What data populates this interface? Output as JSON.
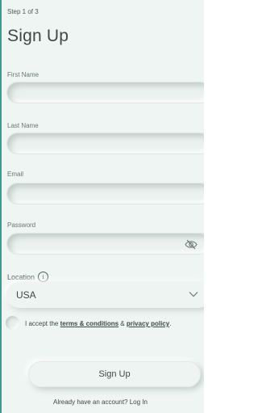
{
  "step": "Step 1 of 3",
  "title": "Sign Up",
  "fields": {
    "first_name": {
      "label": "First Name",
      "value": ""
    },
    "last_name": {
      "label": "Last Name",
      "value": ""
    },
    "email": {
      "label": "Email",
      "value": ""
    },
    "password": {
      "label": "Password",
      "value": ""
    }
  },
  "location": {
    "label": "Location",
    "info_glyph": "i",
    "selected": "USA"
  },
  "terms": {
    "prefix": "I accept the ",
    "terms_link": "terms & conditions",
    "middle": " & ",
    "privacy_link": "privacy policy",
    "suffix": "."
  },
  "submit_label": "Sign Up",
  "login": {
    "prompt": "Already have an account? ",
    "link": "Log In"
  },
  "icons": {
    "password_toggle": "eye-slash-icon",
    "select": "chevron-down-icon",
    "location_info": "info-icon"
  },
  "colors": {
    "accent_border": "#3f9a8e",
    "background": "#eef5f2",
    "text": "#3d4a48"
  }
}
